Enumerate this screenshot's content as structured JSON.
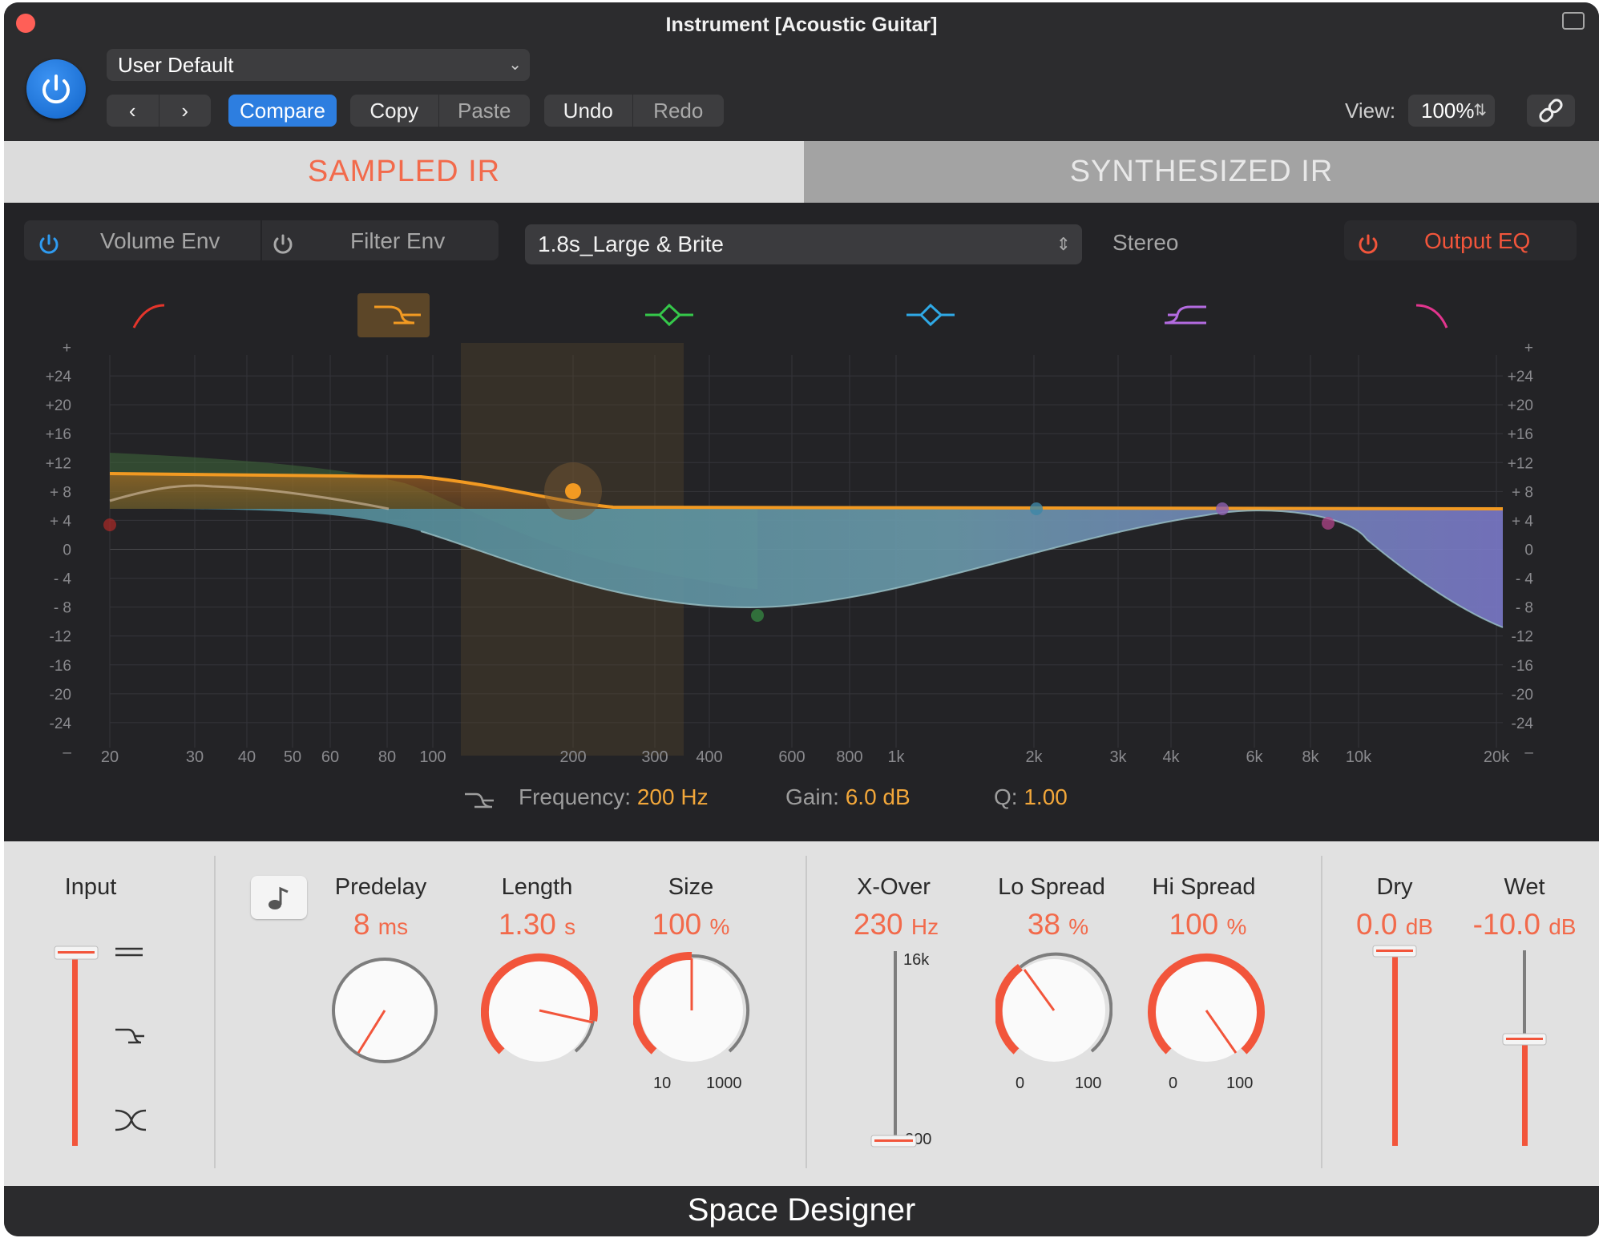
{
  "window": {
    "title": "Instrument [Acoustic Guitar]"
  },
  "header": {
    "preset": "User Default",
    "compare": "Compare",
    "copy": "Copy",
    "paste": "Paste",
    "undo": "Undo",
    "redo": "Redo",
    "view_label": "View:",
    "view_value": "100%"
  },
  "tabs": [
    {
      "label": "SAMPLED IR",
      "active": true
    },
    {
      "label": "SYNTHESIZED IR",
      "active": false
    }
  ],
  "eq_bar": {
    "volume_env": "Volume Env",
    "filter_env": "Filter Env",
    "ir_file": "1.8s_Large & Brite",
    "stereo": "Stereo",
    "output_eq": "Output EQ"
  },
  "eq": {
    "db_labels": [
      "+",
      "+24",
      "+20",
      "+16",
      "+12",
      "+ 8",
      "+ 4",
      "0",
      "- 4",
      "- 8",
      "-12",
      "-16",
      "-20",
      "-24",
      "–"
    ],
    "freq_labels": [
      "20",
      "30",
      "40",
      "50",
      "60",
      "80",
      "100",
      "200",
      "300",
      "400",
      "600",
      "800",
      "1k",
      "2k",
      "3k",
      "4k",
      "6k",
      "8k",
      "10k",
      "20k"
    ],
    "bands": [
      {
        "type": "low-cut",
        "color": "#e5352b"
      },
      {
        "type": "low-shelf",
        "color": "#f29a22",
        "selected": true
      },
      {
        "type": "bell",
        "color": "#35c84a"
      },
      {
        "type": "bell",
        "color": "#2fa9e6"
      },
      {
        "type": "high-shelf",
        "color": "#b36be0"
      },
      {
        "type": "high-cut",
        "color": "#e2358e"
      }
    ],
    "readout": {
      "freq_label": "Frequency:",
      "freq_value": "200 Hz",
      "gain_label": "Gain:",
      "gain_value": "6.0 dB",
      "q_label": "Q:",
      "q_value": "1.00"
    }
  },
  "controls": {
    "input": {
      "label": "Input"
    },
    "predelay": {
      "label": "Predelay",
      "value": "8",
      "unit": "ms"
    },
    "length": {
      "label": "Length",
      "value": "1.30",
      "unit": "s"
    },
    "size": {
      "label": "Size",
      "value": "100",
      "unit": "%",
      "min": "10",
      "max": "1000"
    },
    "xover": {
      "label": "X-Over",
      "value": "230",
      "unit": "Hz",
      "top": "16k",
      "bottom": "200"
    },
    "lo_spread": {
      "label": "Lo Spread",
      "value": "38",
      "unit": "%",
      "min": "0",
      "max": "100"
    },
    "hi_spread": {
      "label": "Hi Spread",
      "value": "100",
      "unit": "%",
      "min": "0",
      "max": "100"
    },
    "dry": {
      "label": "Dry",
      "value": "0.0",
      "unit": "dB"
    },
    "wet": {
      "label": "Wet",
      "value": "-10.0",
      "unit": "dB"
    }
  },
  "footer": {
    "name": "Space Designer"
  }
}
